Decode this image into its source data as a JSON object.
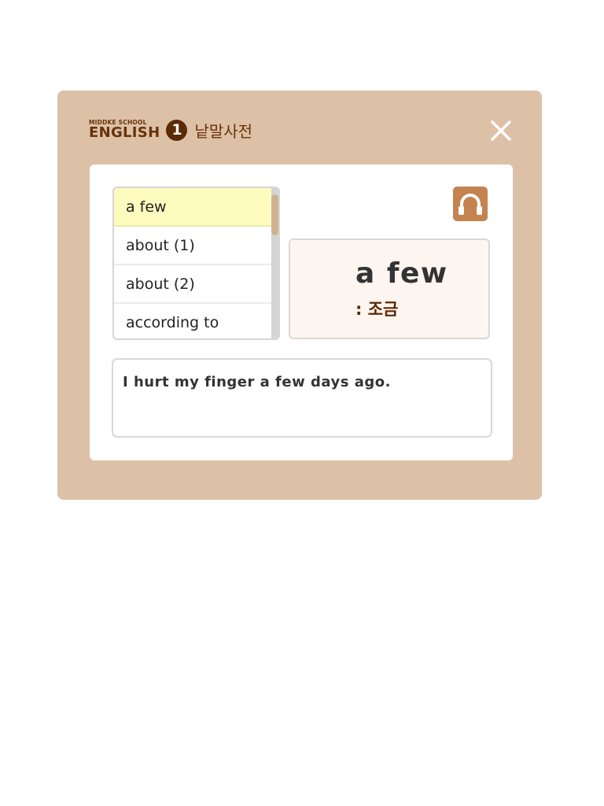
{
  "header": {
    "logo_top": "MIDDKE SCHOOL",
    "logo_main": "ENGLISH",
    "logo_number": "1",
    "title": "낱말사전",
    "close_icon": "close-icon"
  },
  "word_list": {
    "items": [
      {
        "label": "a few",
        "selected": true
      },
      {
        "label": "about (1)",
        "selected": false
      },
      {
        "label": "about (2)",
        "selected": false
      },
      {
        "label": "according to",
        "selected": false
      }
    ]
  },
  "audio": {
    "icon": "headphones-icon"
  },
  "word_card": {
    "word": "a few",
    "meaning": ": 조금"
  },
  "example": {
    "sentence": "I hurt my finger a few days ago."
  },
  "colors": {
    "dialog_bg": "#dcc1a7",
    "brand_brown": "#6a3208",
    "selected_item": "#fefbbf",
    "audio_button": "#c4834f",
    "card_bg": "#fdf5ef"
  }
}
